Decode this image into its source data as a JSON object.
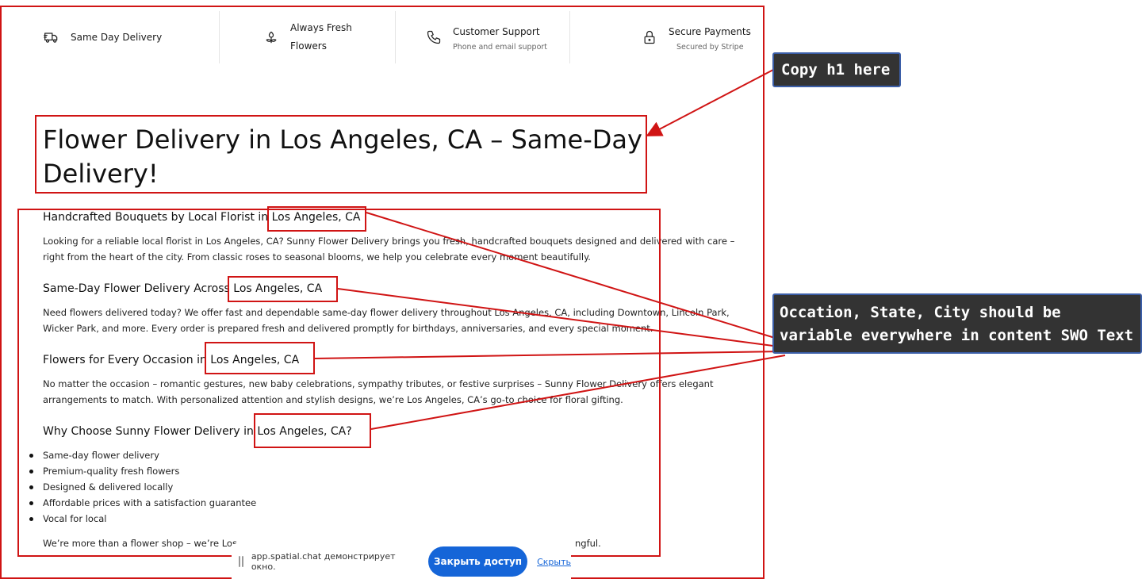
{
  "features": [
    {
      "icon": "truck-icon",
      "title": "Same Day Delivery",
      "subtitle": ""
    },
    {
      "icon": "flower-icon",
      "title": "Always Fresh Flowers",
      "subtitle": ""
    },
    {
      "icon": "phone-icon",
      "title": "Customer Support",
      "subtitle": "Phone and email support"
    },
    {
      "icon": "lock-icon",
      "title": "Secure Payments",
      "subtitle": "Secured by Stripe"
    }
  ],
  "headline": "Flower Delivery in Los Angeles, CA – Same-Day Delivery!",
  "sections": [
    {
      "heading": "Handcrafted Bouquets by Local Florist in Los Angeles, CA",
      "body": "Looking for a reliable local florist in Los Angeles, CA? Sunny Flower Delivery brings you fresh, handcrafted bouquets designed and delivered with care – right from the heart of the city. From classic roses to seasonal blooms, we help you celebrate every moment beautifully."
    },
    {
      "heading": "Same-Day Flower Delivery Across Los Angeles, CA",
      "body": "Need flowers delivered today? We offer fast and dependable same-day flower delivery throughout Los Angeles, CA, including Downtown, Lincoln Park, Wicker Park, and more. Every order is prepared fresh and delivered promptly for birthdays, anniversaries, and every special moment."
    },
    {
      "heading": "Flowers for Every Occasion in Los Angeles, CA",
      "body": "No matter the occasion – romantic gestures, new baby celebrations, sympathy tributes, or festive surprises – Sunny Flower Delivery offers elegant arrangements to match. With personalized attention and stylish designs, we’re Los Angeles, CA’s go-to choice for floral gifting."
    },
    {
      "heading": "Why Choose Sunny Flower Delivery in Los Angeles, CA?",
      "body": ""
    }
  ],
  "bullets": [
    "Same-day flower delivery",
    "Premium-quality fresh flowers",
    "Designed & delivered locally",
    "Affordable prices with a satisfaction guarantee",
    "Vocal for local"
  ],
  "closing": "We’re more than a flower shop – we’re Los",
  "closing_tail": "ngful.",
  "annotations": {
    "copy_h1": "Copy h1 here",
    "variables_line1": "Occation, State, City should be",
    "variables_line2": "variable everywhere in content SWO Text"
  },
  "sharebar": {
    "text": "app.spatial.chat демонстрирует окно.",
    "stop_label": "Закрыть доступ",
    "hide_label": "Скрыть"
  },
  "colors": {
    "annotation_red": "#d01414",
    "callout_bg": "#333333",
    "callout_border": "#3b5ea8",
    "share_button": "#1565d8"
  }
}
